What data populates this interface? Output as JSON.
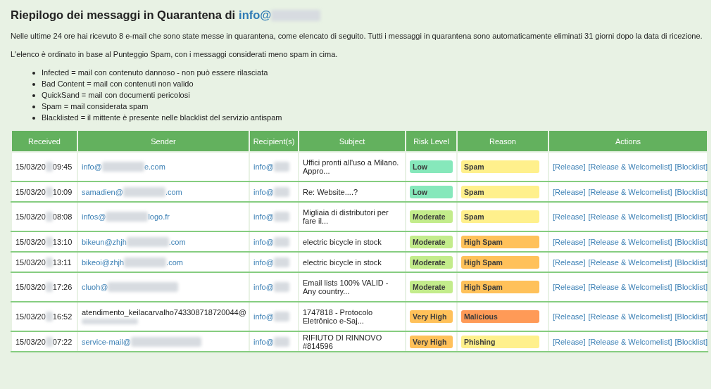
{
  "heading": {
    "text": "Riepilogo dei messaggi in Quarantena di ",
    "address": "info@"
  },
  "intro": "Nelle ultime 24 ore hai ricevuto 8 e-mail che sono state messe in quarantena, come elencato di seguito. Tutti i messaggi in quarantena sono automaticamente eliminati 31 giorni dopo la data di ricezione.",
  "order_note": "L'elenco è ordinato in base al Punteggio Spam, con i messaggi considerati meno spam in cima.",
  "legend": [
    "Infected = mail con contenuto dannoso - non può essere rilasciata",
    "Bad Content = mail con contenuti non valido",
    "QuickSand = mail con documenti pericolosi",
    "Spam = mail considerata spam",
    "Blacklisted = il mittente è presente nelle blacklist del servizio antispam"
  ],
  "table": {
    "columns": [
      "Received",
      "Sender",
      "Recipient(s)",
      "Subject",
      "Risk Level",
      "Reason",
      "Actions"
    ],
    "rows": [
      {
        "received": {
          "date": "15/03/20",
          "time": "09:45"
        },
        "sender": {
          "kind": "link",
          "start": "info@",
          "end": "e.com"
        },
        "recipient": "info@",
        "subject": "Uffici pronti all'uso a Milano. Appro...",
        "risk": {
          "label": "Low",
          "color": "#86e8bb"
        },
        "reason": {
          "label": "Spam",
          "color": "#fff08c"
        },
        "actions": [
          "[Release]",
          "[Release & Welcomelist]",
          "[Blocklist]"
        ]
      },
      {
        "received": {
          "date": "15/03/20",
          "time": "10:09"
        },
        "sender": {
          "kind": "link",
          "start": "samadien@",
          "end": ".com"
        },
        "recipient": "info@",
        "subject": "Re: Website....?",
        "risk": {
          "label": "Low",
          "color": "#86e8bb"
        },
        "reason": {
          "label": "Spam",
          "color": "#fff08c"
        },
        "actions": [
          "[Release]",
          "[Release & Welcomelist]",
          "[Blocklist]"
        ]
      },
      {
        "received": {
          "date": "15/03/20",
          "time": "08:08"
        },
        "sender": {
          "kind": "link",
          "start": "infos@",
          "end": "logo.fr"
        },
        "recipient": "info@",
        "subject": "Migliaia di distributori per fare il...",
        "risk": {
          "label": "Moderate",
          "color": "#c3ec8b"
        },
        "reason": {
          "label": "Spam",
          "color": "#fff08c"
        },
        "actions": [
          "[Release]",
          "[Release & Welcomelist]",
          "[Blocklist]"
        ]
      },
      {
        "received": {
          "date": "15/03/20",
          "time": "13:10"
        },
        "sender": {
          "kind": "link",
          "start": "bikeun@zhjh",
          "end": ".com"
        },
        "recipient": "info@",
        "subject": "electric bicycle in stock",
        "risk": {
          "label": "Moderate",
          "color": "#c3ec8b"
        },
        "reason": {
          "label": "High Spam",
          "color": "#ffc15a"
        },
        "actions": [
          "[Release]",
          "[Release & Welcomelist]",
          "[Blocklist]"
        ]
      },
      {
        "received": {
          "date": "15/03/20",
          "time": "13:11"
        },
        "sender": {
          "kind": "link",
          "start": "bikeoi@zhjh",
          "end": ".com"
        },
        "recipient": "info@",
        "subject": "electric bicycle in stock",
        "risk": {
          "label": "Moderate",
          "color": "#c3ec8b"
        },
        "reason": {
          "label": "High Spam",
          "color": "#ffc15a"
        },
        "actions": [
          "[Release]",
          "[Release & Welcomelist]",
          "[Blocklist]"
        ]
      },
      {
        "received": {
          "date": "15/03/20",
          "time": "17:26"
        },
        "sender": {
          "kind": "link",
          "start": "cluoh@"
        },
        "recipient": "info@",
        "subject": "Email lists 100% VALID - Any country...",
        "risk": {
          "label": "Moderate",
          "color": "#c3ec8b"
        },
        "reason": {
          "label": "High Spam",
          "color": "#ffc15a"
        },
        "actions": [
          "[Release]",
          "[Release & Welcomelist]",
          "[Blocklist]"
        ]
      },
      {
        "received": {
          "date": "15/03/20",
          "time": "16:52"
        },
        "sender": {
          "kind": "plain",
          "start": "atendimento_keilacarvalho743308718720044@"
        },
        "recipient": "info@",
        "subject": "1747818 - Protocolo Eletrônico e-Saj...",
        "risk": {
          "label": "Very High",
          "color": "#ffc15a"
        },
        "reason": {
          "label": "Malicious",
          "color": "#ff9a57"
        },
        "actions": [
          "[Release]",
          "[Release & Welcomelist]",
          "[Blocklist]"
        ]
      },
      {
        "received": {
          "date": "15/03/20",
          "time": "07:22"
        },
        "sender": {
          "kind": "link",
          "start": "service-mail@"
        },
        "recipient": "info@",
        "subject": "RIFIUTO DI RINNOVO #814596",
        "risk": {
          "label": "Very High",
          "color": "#ffc15a"
        },
        "reason": {
          "label": "Phishing",
          "color": "#fff08c"
        },
        "actions": [
          "[Release]",
          "[Release & Welcomelist]",
          "[Blocklist]"
        ]
      }
    ]
  }
}
